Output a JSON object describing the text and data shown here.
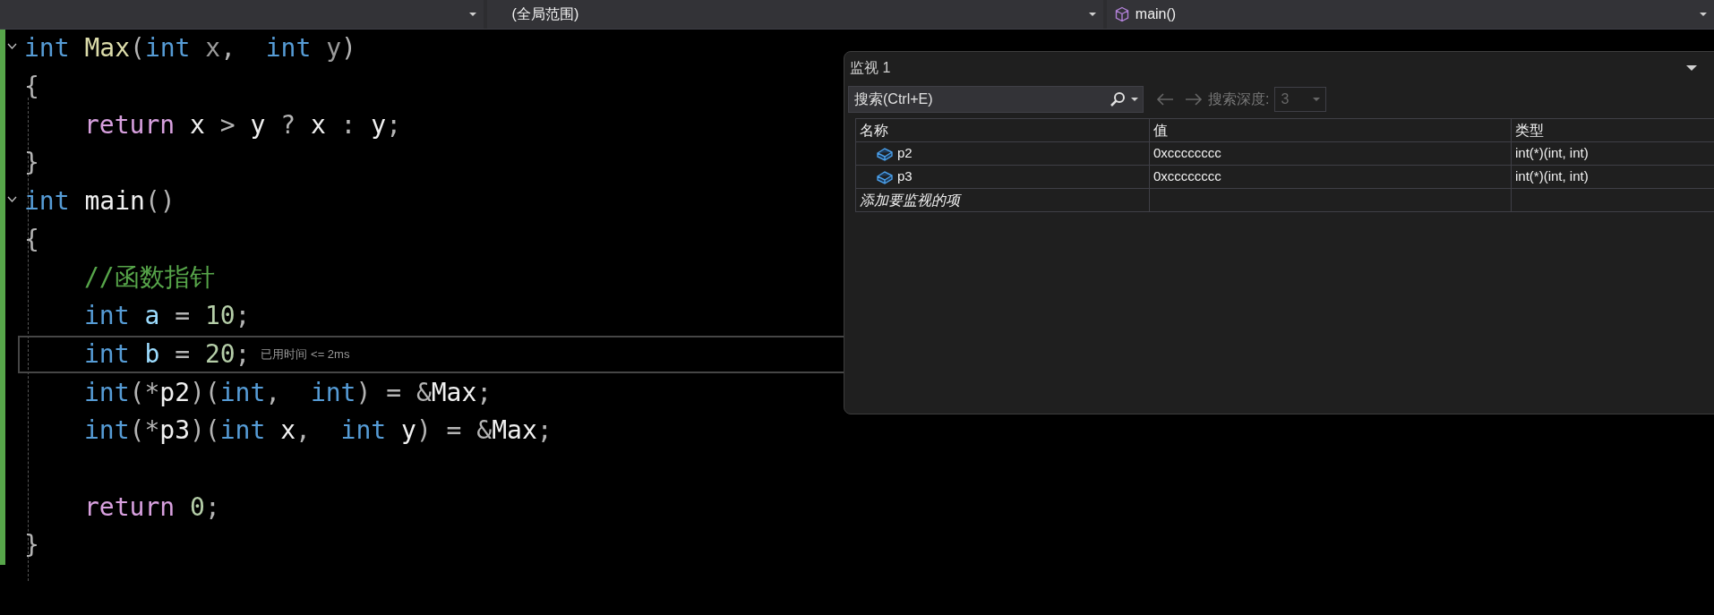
{
  "nav_bar": {
    "dropdowns": [
      {
        "kind": "project"
      },
      {
        "kind": "scope",
        "text": "(全局范围)"
      },
      {
        "kind": "member",
        "text": "main()"
      }
    ]
  },
  "editor": {
    "lines": [
      {
        "foldable": true,
        "indented": false,
        "current": false,
        "tokens": [
          {
            "kind": "keyword",
            "text": "int "
          },
          {
            "kind": "function",
            "text": "Max"
          },
          {
            "kind": "punctuation",
            "text": "("
          },
          {
            "kind": "keyword",
            "text": "int "
          },
          {
            "kind": "parameter",
            "text": "x"
          },
          {
            "kind": "punctuation",
            "text": ",  "
          },
          {
            "kind": "keyword",
            "text": "int "
          },
          {
            "kind": "parameter",
            "text": "y"
          },
          {
            "kind": "punctuation",
            "text": ")"
          }
        ]
      },
      {
        "foldable": false,
        "indented": false,
        "current": false,
        "tokens": [
          {
            "kind": "punctuation",
            "text": "{"
          }
        ]
      },
      {
        "foldable": false,
        "indented": true,
        "current": false,
        "tokens": [
          {
            "kind": "control",
            "text": "return "
          },
          {
            "kind": "identifier",
            "text": "x "
          },
          {
            "kind": "punctuation",
            "text": "> "
          },
          {
            "kind": "identifier",
            "text": "y "
          },
          {
            "kind": "punctuation",
            "text": "? "
          },
          {
            "kind": "identifier",
            "text": "x "
          },
          {
            "kind": "punctuation",
            "text": ": "
          },
          {
            "kind": "identifier",
            "text": "y"
          },
          {
            "kind": "punctuation",
            "text": ";"
          }
        ]
      },
      {
        "foldable": false,
        "indented": false,
        "current": false,
        "tokens": [
          {
            "kind": "punctuation",
            "text": "}"
          }
        ]
      },
      {
        "foldable": true,
        "indented": false,
        "current": false,
        "tokens": [
          {
            "kind": "keyword",
            "text": "int "
          },
          {
            "kind": "identifier",
            "text": "main"
          },
          {
            "kind": "punctuation",
            "text": "()"
          }
        ]
      },
      {
        "foldable": false,
        "indented": false,
        "current": false,
        "tokens": [
          {
            "kind": "punctuation",
            "text": "{"
          }
        ]
      },
      {
        "foldable": false,
        "indented": true,
        "current": false,
        "tokens": [
          {
            "kind": "comment",
            "text": "//函数指针"
          }
        ]
      },
      {
        "foldable": false,
        "indented": true,
        "current": false,
        "tokens": [
          {
            "kind": "keyword",
            "text": "int "
          },
          {
            "kind": "local",
            "text": "a "
          },
          {
            "kind": "punctuation",
            "text": "= "
          },
          {
            "kind": "number",
            "text": "10"
          },
          {
            "kind": "punctuation",
            "text": ";"
          }
        ]
      },
      {
        "foldable": false,
        "indented": true,
        "current": true,
        "hint": "已用时间 <= 2ms",
        "tokens": [
          {
            "kind": "keyword",
            "text": "int "
          },
          {
            "kind": "local",
            "text": "b "
          },
          {
            "kind": "punctuation",
            "text": "= "
          },
          {
            "kind": "number",
            "text": "20"
          },
          {
            "kind": "punctuation",
            "text": ";"
          }
        ]
      },
      {
        "foldable": false,
        "indented": true,
        "current": false,
        "tokens": [
          {
            "kind": "keyword",
            "text": "int"
          },
          {
            "kind": "punctuation",
            "text": "(*"
          },
          {
            "kind": "identifier",
            "text": "p2"
          },
          {
            "kind": "punctuation",
            "text": ")("
          },
          {
            "kind": "keyword",
            "text": "int"
          },
          {
            "kind": "punctuation",
            "text": ",  "
          },
          {
            "kind": "keyword",
            "text": "int"
          },
          {
            "kind": "punctuation",
            "text": ") = &"
          },
          {
            "kind": "identifier",
            "text": "Max"
          },
          {
            "kind": "punctuation",
            "text": ";"
          }
        ]
      },
      {
        "foldable": false,
        "indented": true,
        "current": false,
        "tokens": [
          {
            "kind": "keyword",
            "text": "int"
          },
          {
            "kind": "punctuation",
            "text": "(*"
          },
          {
            "kind": "identifier",
            "text": "p3"
          },
          {
            "kind": "punctuation",
            "text": ")("
          },
          {
            "kind": "keyword",
            "text": "int "
          },
          {
            "kind": "identifier",
            "text": "x"
          },
          {
            "kind": "punctuation",
            "text": ",  "
          },
          {
            "kind": "keyword",
            "text": "int "
          },
          {
            "kind": "identifier",
            "text": "y"
          },
          {
            "kind": "punctuation",
            "text": ") = &"
          },
          {
            "kind": "identifier",
            "text": "Max"
          },
          {
            "kind": "punctuation",
            "text": ";"
          }
        ]
      },
      {
        "foldable": false,
        "current": false
      },
      {
        "foldable": false,
        "indented": true,
        "current": false,
        "tokens": [
          {
            "kind": "control",
            "text": "return "
          },
          {
            "kind": "number",
            "text": "0"
          },
          {
            "kind": "punctuation",
            "text": ";"
          }
        ]
      },
      {
        "foldable": false,
        "indented": false,
        "current": false,
        "tokens": [
          {
            "kind": "punctuation",
            "text": "}"
          }
        ]
      }
    ]
  },
  "watch": {
    "title": "监视 1",
    "search": {
      "placeholder": "搜索(Ctrl+E)"
    },
    "depth_label": "搜索深度:",
    "depth": "3",
    "columns": [
      "名称",
      "值",
      "类型"
    ],
    "rows": [
      {
        "name": "p2",
        "value": "0xcccccccc",
        "type": "int(*)(int, int)"
      },
      {
        "name": "p3",
        "value": "0xcccccccc",
        "type": "int(*)(int, int)"
      }
    ],
    "add_placeholder": "添加要监视的项"
  }
}
